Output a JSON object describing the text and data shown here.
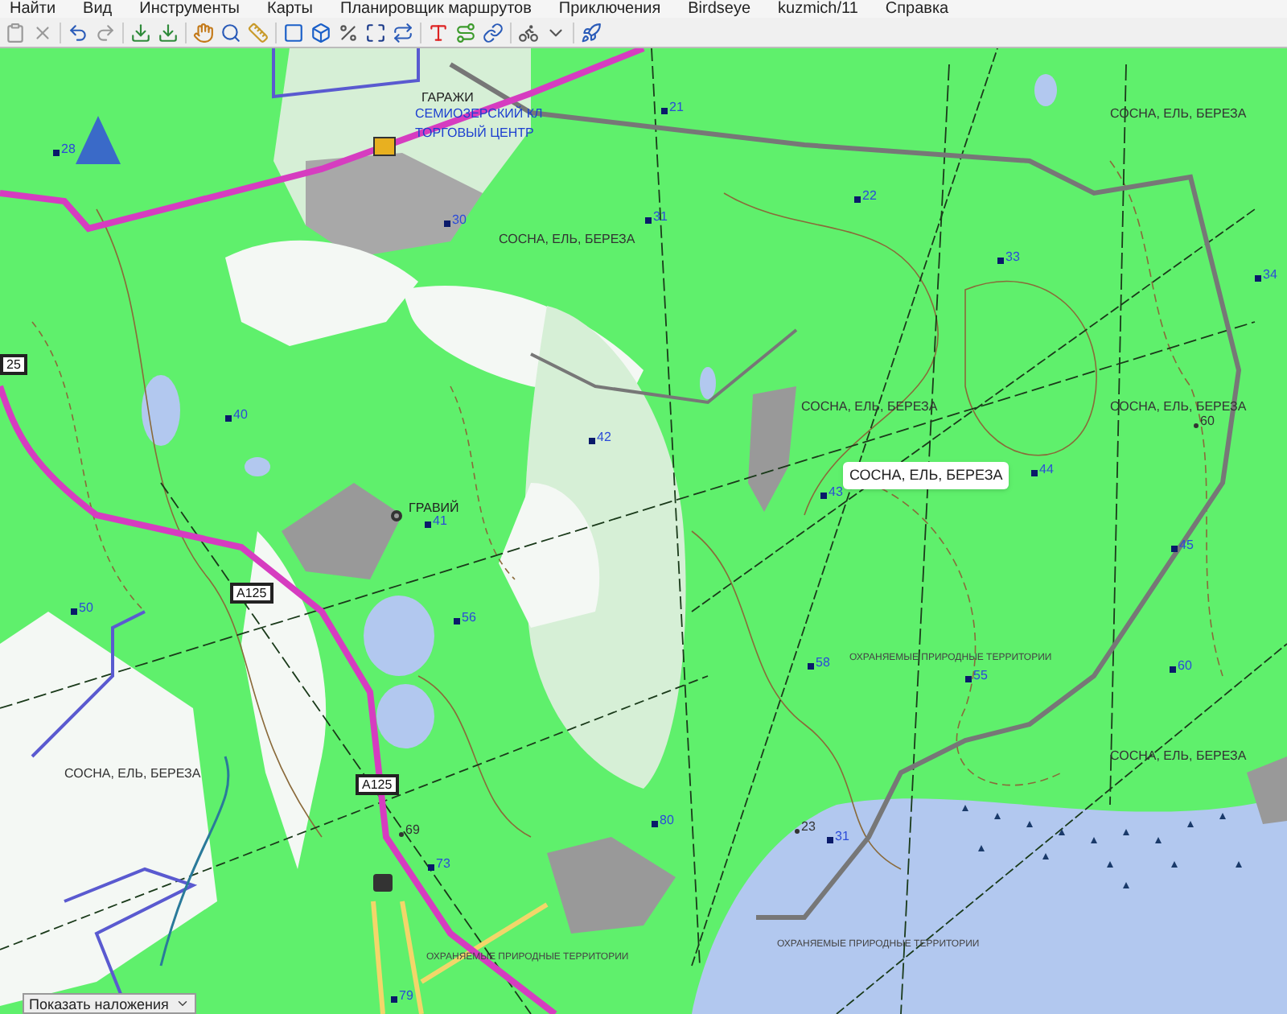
{
  "menu": [
    "Найти",
    "Вид",
    "Инструменты",
    "Карты",
    "Планировщик маршрутов",
    "Приключения",
    "Birdseye",
    "kuzmich/11",
    "Справка"
  ],
  "map": {
    "labels": [
      {
        "text": "ГАРАЖИ",
        "kind": "place_dark"
      },
      {
        "text": "СЕМИОЗЕРСКИЙ КЛ",
        "kind": "place"
      },
      {
        "text": "ТОРГОВЫЙ ЦЕНТР",
        "kind": "place"
      },
      {
        "text": "21",
        "kind": "height"
      },
      {
        "text": "22",
        "kind": "height"
      },
      {
        "text": "31",
        "kind": "height"
      },
      {
        "text": "30",
        "kind": "height"
      },
      {
        "text": "28",
        "kind": "height"
      },
      {
        "text": "СОСНА, ЕЛЬ, БЕРЕЗА",
        "kind": "forest"
      },
      {
        "text": "СОСНА, ЕЛЬ, БЕРЕЗА",
        "kind": "forest"
      },
      {
        "text": "33",
        "kind": "height"
      },
      {
        "text": "34",
        "kind": "height"
      },
      {
        "text": "СОСНА, ЕЛЬ, БЕРЕЗА",
        "kind": "forest"
      },
      {
        "text": "СОСНА, ЕЛЬ, БЕРЕЗА",
        "kind": "forest"
      },
      {
        "text": "40",
        "kind": "height"
      },
      {
        "text": "42",
        "kind": "height"
      },
      {
        "text": "ГРАВИЙ",
        "kind": "place_dark"
      },
      {
        "text": "41",
        "kind": "height"
      },
      {
        "text": "43",
        "kind": "height"
      },
      {
        "text": "44",
        "kind": "height"
      },
      {
        "text": "60",
        "kind": "spot"
      },
      {
        "text": "45",
        "kind": "height"
      },
      {
        "text": "50",
        "kind": "height"
      },
      {
        "text": "56",
        "kind": "height"
      },
      {
        "text": "ОХРАНЯЕМЫЕ ПРИРОДНЫЕ ТЕРРИТОРИИ",
        "kind": "protected"
      },
      {
        "text": "58",
        "kind": "height"
      },
      {
        "text": "55",
        "kind": "height"
      },
      {
        "text": "60",
        "kind": "height"
      },
      {
        "text": "СОСНА, ЕЛЬ, БЕРЕЗА",
        "kind": "forest"
      },
      {
        "text": "СОСНА, ЕЛЬ, БЕРЕЗА",
        "kind": "forest"
      },
      {
        "text": "69",
        "kind": "spot"
      },
      {
        "text": "80",
        "kind": "height"
      },
      {
        "text": "23",
        "kind": "spot"
      },
      {
        "text": "31",
        "kind": "height"
      },
      {
        "text": "73",
        "kind": "height"
      },
      {
        "text": "ОХРАНЯЕМЫЕ ПРИРОДНЫЕ ТЕРРИТОРИИ",
        "kind": "protected"
      },
      {
        "text": "ОХРАНЯЕМЫЕ ПРИРОДНЫЕ ТЕРРИТОРИИ",
        "kind": "protected"
      },
      {
        "text": "79",
        "kind": "height"
      }
    ],
    "road_shields": [
      "25",
      "А125",
      "А125"
    ],
    "tooltip": "СОСНА, ЕЛЬ, БЕРЕЗА"
  },
  "overlay_dropdown": "Показать наложения"
}
